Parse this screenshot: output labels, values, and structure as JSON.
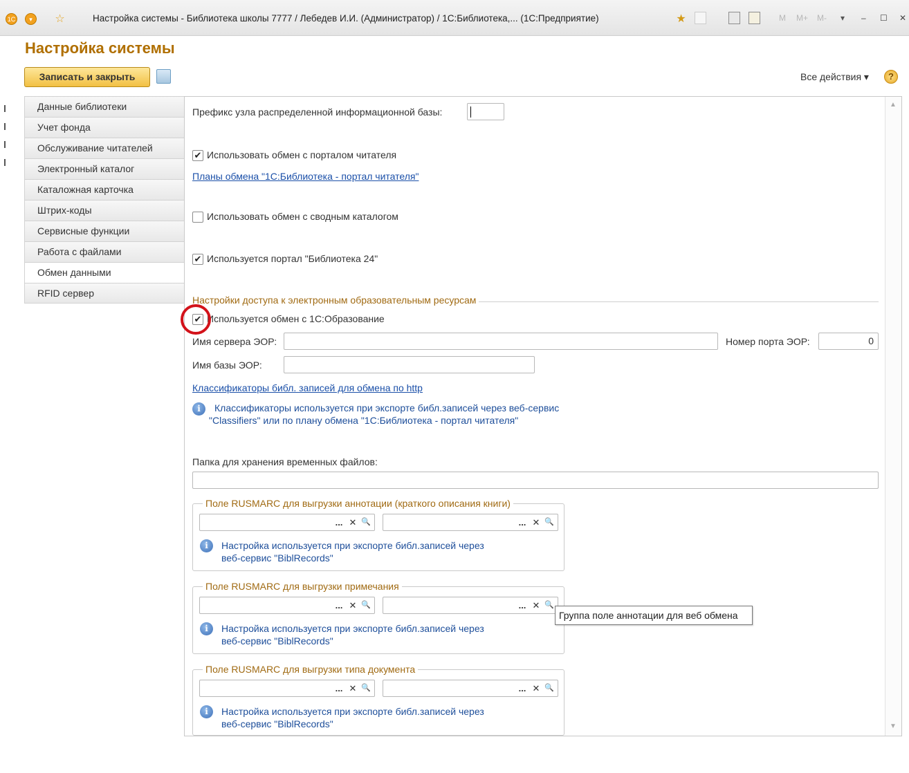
{
  "window": {
    "title": "Настройка системы - Библиотека школы 7777 / Лебедев И.И. (Администратор) /  1С:Библиотека,... (1С:Предприятие)",
    "memory_buttons": [
      "M",
      "M+",
      "M-"
    ]
  },
  "page": {
    "title": "Настройка системы"
  },
  "toolbar": {
    "save_close_label": "Записать и закрыть",
    "all_actions_label": "Все действия ▾",
    "help_label": "?"
  },
  "sidebar": {
    "items": [
      {
        "label": "Данные библиотеки"
      },
      {
        "label": "Учет фонда"
      },
      {
        "label": "Обслуживание читателей"
      },
      {
        "label": "Электронный каталог"
      },
      {
        "label": "Каталожная карточка"
      },
      {
        "label": "Штрих-коды"
      },
      {
        "label": "Сервисные функции"
      },
      {
        "label": "Работа с файлами"
      },
      {
        "label": "Обмен данными",
        "active": true
      },
      {
        "label": "RFID сервер"
      }
    ]
  },
  "main": {
    "prefix_label": "Префикс узла распределенной информационной базы:",
    "prefix_value": "",
    "portal_exchange": {
      "label": "Использовать обмен с порталом читателя",
      "checked": true
    },
    "exchange_plans_link": "Планы обмена \"1С:Библиотека - портал читателя\"",
    "summary_catalog": {
      "label": "Использовать обмен с сводным каталогом",
      "checked": false
    },
    "library24": {
      "label": "Используется портал \"Библиотека 24\"",
      "checked": true
    },
    "eor_section_title": "Настройки доступа к электронным образовательным ресурсам",
    "eor_exchange": {
      "label": "Используется обмен с 1С:Образование",
      "checked": true
    },
    "eor_server_label": "Имя сервера ЭОР:",
    "eor_server_value": "",
    "eor_port_label": "Номер порта ЭОР:",
    "eor_port_value": "0",
    "eor_db_label": "Имя базы ЭОР:",
    "eor_db_value": "",
    "classifiers_link": "Классификаторы библ. записей для обмена по http",
    "classifiers_info_line1": "Классификаторы используется при экспорте библ.записей через веб-сервис",
    "classifiers_info_line2": "\"Classifiers\" или по плану обмена \"1С:Библиотека - портал читателя\"",
    "temp_folder_label": "Папка для хранения временных файлов:",
    "temp_folder_value": "",
    "groups": [
      {
        "title": "Поле RUSMARC для выгрузки аннотации (краткого описания книги)",
        "info_line1": "Настройка используется при экспорте библ.записей через",
        "info_line2": "веб-сервис \"BiblRecords\""
      },
      {
        "title": "Поле RUSMARC для выгрузки примечания",
        "info_line1": "Настройка используется при экспорте библ.записей через",
        "info_line2": "веб-сервис \"BiblRecords\""
      },
      {
        "title": "Поле RUSMARC для выгрузки типа документа",
        "info_line1": "Настройка используется при экспорте библ.записей через",
        "info_line2": "веб-сервис \"BiblRecords\""
      }
    ],
    "field_buttons": {
      "select": "...",
      "clear": "✕",
      "search": "🔍"
    }
  },
  "tooltip": {
    "text": "Группа поле аннотации для веб обмена"
  },
  "colors": {
    "title": "#b06f00",
    "link": "#1a4fa8",
    "highlight_circle": "#d3121a",
    "section": "#a06a12"
  }
}
